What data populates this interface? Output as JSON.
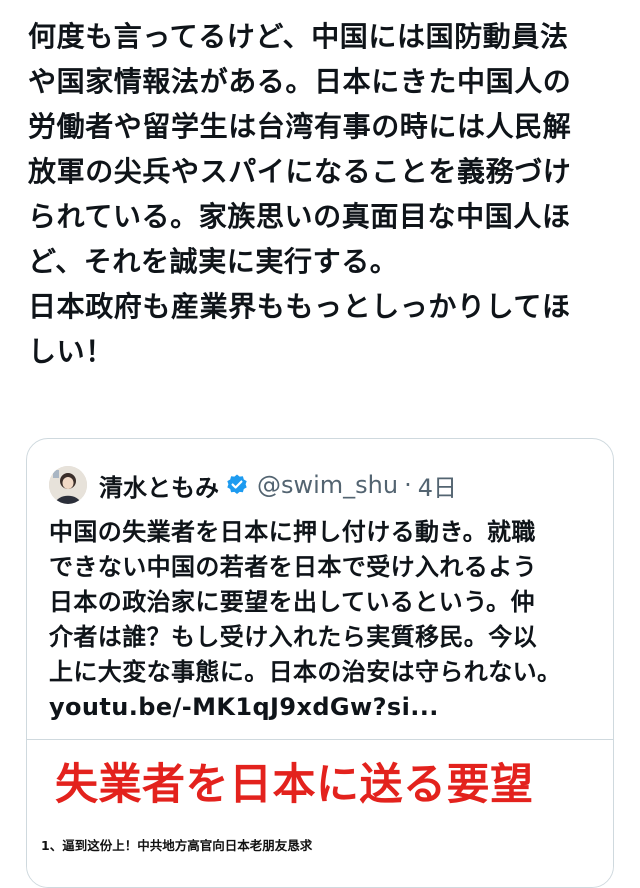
{
  "tweet": {
    "lines": [
      "何度も言ってるけど、中国には国防動員法",
      "や国家情報法がある。日本にきた中国人の",
      "労働者や留学生は台湾有事の時には人民解",
      "放軍の尖兵やスパイになることを義務づけ",
      "られている。家族思いの真面目な中国人ほ",
      "ど、それを誠実に実行する。",
      "日本政府も産業界ももっとしっかりしてほ",
      "しい！"
    ]
  },
  "quote": {
    "author_name": "清水ともみ",
    "handle": "@swim_shu",
    "separator": "·",
    "time": "4日",
    "lines": [
      "中国の失業者を日本に押し付ける動き。就職",
      "できない中国の若者を日本で受け入れるよう",
      "日本の政治家に要望を出しているという。仲",
      "介者は誰？もし受け入れたら実質移民。今以",
      "上に大変な事態に。日本の治安は守られない。",
      "youtu.be/-MK1qJ9xdGw?si..."
    ],
    "media": {
      "headline": "失業者を日本に送る要望",
      "caption": "1、逼到这份上！中共地方高官向日本老朋友恳求"
    },
    "icons": {
      "avatar": "avatar",
      "verified": "verified-badge-icon"
    }
  },
  "colors": {
    "text": "#0f1419",
    "secondary": "#536471",
    "verified": "#1d9bf0",
    "headline_red": "#e3221d",
    "border": "#cfd9de"
  }
}
